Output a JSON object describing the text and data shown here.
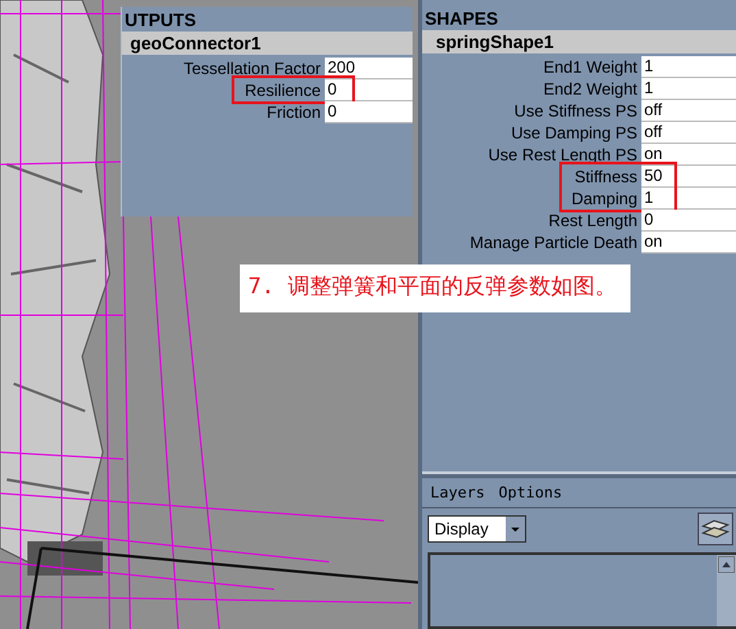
{
  "outputs_panel": {
    "header": "UTPUTS",
    "node": "geoConnector1",
    "attributes": [
      {
        "label": "Tessellation Factor",
        "value": "200",
        "highlighted": false
      },
      {
        "label": "Resilience",
        "value": "0",
        "highlighted": true
      },
      {
        "label": "Friction",
        "value": "0",
        "highlighted": false
      }
    ]
  },
  "shapes_panel": {
    "header": "SHAPES",
    "node": "springShape1",
    "attributes": [
      {
        "label": "End1 Weight",
        "value": "1",
        "highlighted": false
      },
      {
        "label": "End2 Weight",
        "value": "1",
        "highlighted": false
      },
      {
        "label": "Use Stiffness PS",
        "value": "off",
        "highlighted": false
      },
      {
        "label": "Use Damping PS",
        "value": "off",
        "highlighted": false
      },
      {
        "label": "Use Rest Length PS",
        "value": "on",
        "highlighted": false
      },
      {
        "label": "Stiffness",
        "value": "50",
        "highlighted": true
      },
      {
        "label": "Damping",
        "value": "1",
        "highlighted": true
      },
      {
        "label": "Rest Length",
        "value": "0",
        "highlighted": false
      },
      {
        "label": "Manage Particle Death",
        "value": "on",
        "highlighted": false
      }
    ]
  },
  "caption": "7. 调整弹簧和平面的反弹参数如图。",
  "layers_panel": {
    "menu": [
      "Layers",
      "Options"
    ],
    "dropdown": {
      "value": "Display"
    }
  }
}
